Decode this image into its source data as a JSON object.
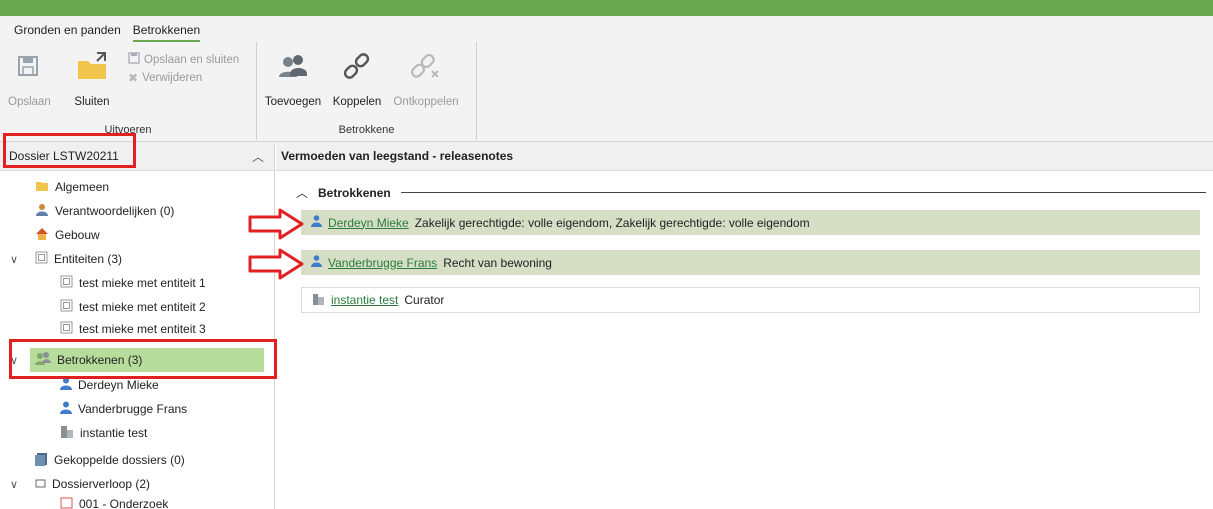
{
  "ribbon": {
    "tabs": [
      "Gronden en panden",
      "Betrokkenen"
    ],
    "groups": {
      "uitvoeren": {
        "caption": "Uitvoeren",
        "buttons": {
          "opslaan": "Opslaan",
          "sluiten": "Sluiten",
          "opslaan_en_sluiten": "Opslaan en sluiten",
          "verwijderen": "Verwijderen"
        }
      },
      "betrokkene": {
        "caption": "Betrokkene",
        "buttons": {
          "toevoegen": "Toevoegen",
          "koppelen": "Koppelen",
          "ontkoppelen": "Ontkoppelen"
        }
      }
    }
  },
  "left": {
    "header": "Dossier LSTW20211",
    "tree": [
      {
        "label": "Algemeen",
        "icon": "folder-icon"
      },
      {
        "label": "Verantwoordelijken (0)",
        "icon": "person-badge-icon"
      },
      {
        "label": "Gebouw",
        "icon": "house-icon"
      },
      {
        "label": "Entiteiten (3)",
        "icon": "entity-icon"
      },
      {
        "label": "test mieke met entiteit 1",
        "icon": "entity-icon"
      },
      {
        "label": "test mieke met entiteit 2",
        "icon": "entity-icon"
      },
      {
        "label": "test mieke met entiteit 3",
        "icon": "entity-icon"
      },
      {
        "label": "Betrokkenen (3)",
        "icon": "people-icon"
      },
      {
        "label": "Derdeyn Mieke",
        "icon": "person-icon"
      },
      {
        "label": "Vanderbrugge Frans",
        "icon": "person-icon"
      },
      {
        "label": "instantie test",
        "icon": "building-icon"
      },
      {
        "label": "Gekoppelde dossiers (0)",
        "icon": "dossier-icon"
      },
      {
        "label": "Dossierverloop (2)",
        "icon": "box-icon"
      },
      {
        "label": "001 - Onderzoek",
        "icon": "stage-icon"
      }
    ]
  },
  "right": {
    "header": "Vermoeden van leegstand - releasenotes",
    "section_title": "Betrokkenen",
    "rows": [
      {
        "name": "Derdeyn Mieke",
        "role": "Zakelijk gerechtigde: volle eigendom, Zakelijk gerechtigde: volle eigendom"
      },
      {
        "name": "Vanderbrugge Frans",
        "role": "Recht van bewoning"
      },
      {
        "name": "instantie test",
        "role": "Curator"
      }
    ]
  },
  "colors": {
    "accent_green": "#6aa84f",
    "selected_green": "#b7dd9c",
    "row_highlight": "#d6dfc5",
    "annotation_red": "#e1201f",
    "link_green": "#2a7d3c"
  }
}
